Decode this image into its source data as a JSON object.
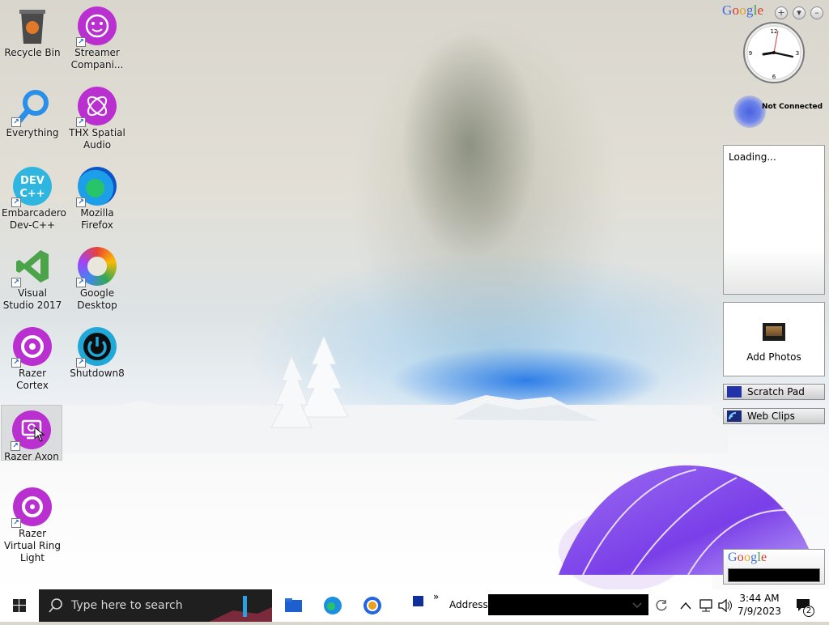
{
  "desktop": {
    "icons": [
      {
        "label": "Recycle Bin"
      },
      {
        "label": "Streamer Compani..."
      },
      {
        "label": "Everything"
      },
      {
        "label": "THX Spatial Audio"
      },
      {
        "label": "Embarcadero Dev-C++"
      },
      {
        "label": "Mozilla Firefox"
      },
      {
        "label": "Visual Studio 2017"
      },
      {
        "label": "Google Desktop"
      },
      {
        "label": "Razer Cortex"
      },
      {
        "label": "Shutdown8"
      },
      {
        "label": "Razer Axon"
      },
      {
        "label": "Razer Virtual Ring Light"
      }
    ]
  },
  "sidebar": {
    "google_logo": [
      "G",
      "o",
      "o",
      "g",
      "l",
      "e"
    ],
    "status_text": "Not Connected",
    "news_loading": "Loading...",
    "photos_label": "Add Photos",
    "scratch_pad": "Scratch Pad",
    "web_clips": "Web Clips",
    "search_logo": [
      "G",
      "o",
      "o",
      "g",
      "l",
      "e"
    ]
  },
  "taskbar": {
    "search_placeholder": "Type here to search",
    "toolbar_chevron": "»",
    "address_label": "Address",
    "time": "3:44 AM",
    "date": "7/9/2023",
    "notification_count": "2"
  },
  "colors": {
    "accent_purple": "#b92fd0",
    "google_blue": "#3b6fd8",
    "google_red": "#d8392b",
    "google_yellow": "#e9a21b",
    "google_green": "#3a9a3f"
  }
}
